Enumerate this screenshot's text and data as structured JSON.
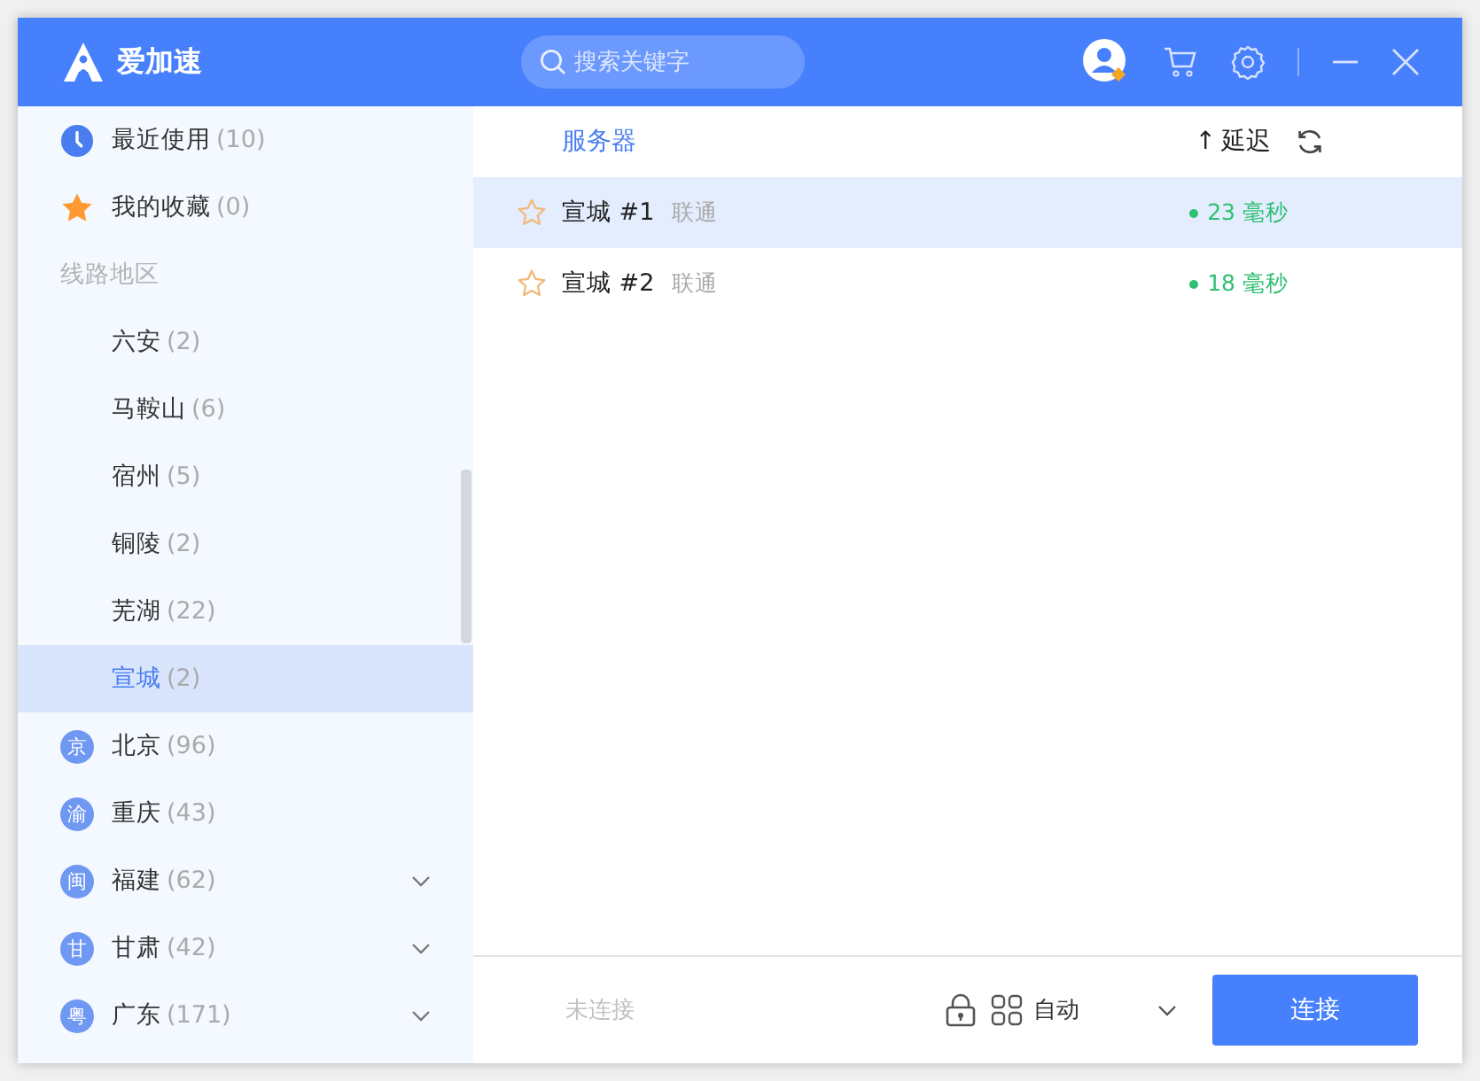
{
  "app": {
    "name": "爱加速"
  },
  "search": {
    "placeholder": "搜索关键字"
  },
  "sidebar": {
    "items": [
      {
        "kind": "recent",
        "label": "最近使用",
        "count": "(10)",
        "selected": false
      },
      {
        "kind": "favorites",
        "label": "我的收藏",
        "count": "(0)",
        "selected": false
      },
      {
        "kind": "section",
        "label": "线路地区"
      },
      {
        "kind": "city",
        "label": "六安",
        "count": "(2)",
        "selected": false
      },
      {
        "kind": "city",
        "label": "马鞍山",
        "count": "(6)",
        "selected": false
      },
      {
        "kind": "city",
        "label": "宿州",
        "count": "(5)",
        "selected": false
      },
      {
        "kind": "city",
        "label": "铜陵",
        "count": "(2)",
        "selected": false
      },
      {
        "kind": "city",
        "label": "芜湖",
        "count": "(22)",
        "selected": false
      },
      {
        "kind": "city",
        "label": "宣城",
        "count": "(2)",
        "selected": true
      },
      {
        "kind": "region",
        "badge": "京",
        "label": "北京",
        "count": "(96)",
        "expandable": false,
        "selected": false
      },
      {
        "kind": "region",
        "badge": "渝",
        "label": "重庆",
        "count": "(43)",
        "expandable": false,
        "selected": false
      },
      {
        "kind": "region",
        "badge": "闽",
        "label": "福建",
        "count": "(62)",
        "expandable": true,
        "selected": false
      },
      {
        "kind": "region",
        "badge": "甘",
        "label": "甘肃",
        "count": "(42)",
        "expandable": true,
        "selected": false
      },
      {
        "kind": "region",
        "badge": "粤",
        "label": "广东",
        "count": "(171)",
        "expandable": true,
        "selected": false
      }
    ]
  },
  "table": {
    "columns": {
      "server": "服务器",
      "sort_arrow": "↑",
      "latency": "延迟"
    },
    "rows": [
      {
        "name": "宣城 #1",
        "isp": "联通",
        "latency": "23 毫秒",
        "favorite": false,
        "selected": true
      },
      {
        "name": "宣城 #2",
        "isp": "联通",
        "latency": "18 毫秒",
        "favorite": false,
        "selected": false
      }
    ]
  },
  "footer": {
    "status": "未连接",
    "mode": "自动",
    "connect_button": "连接"
  }
}
